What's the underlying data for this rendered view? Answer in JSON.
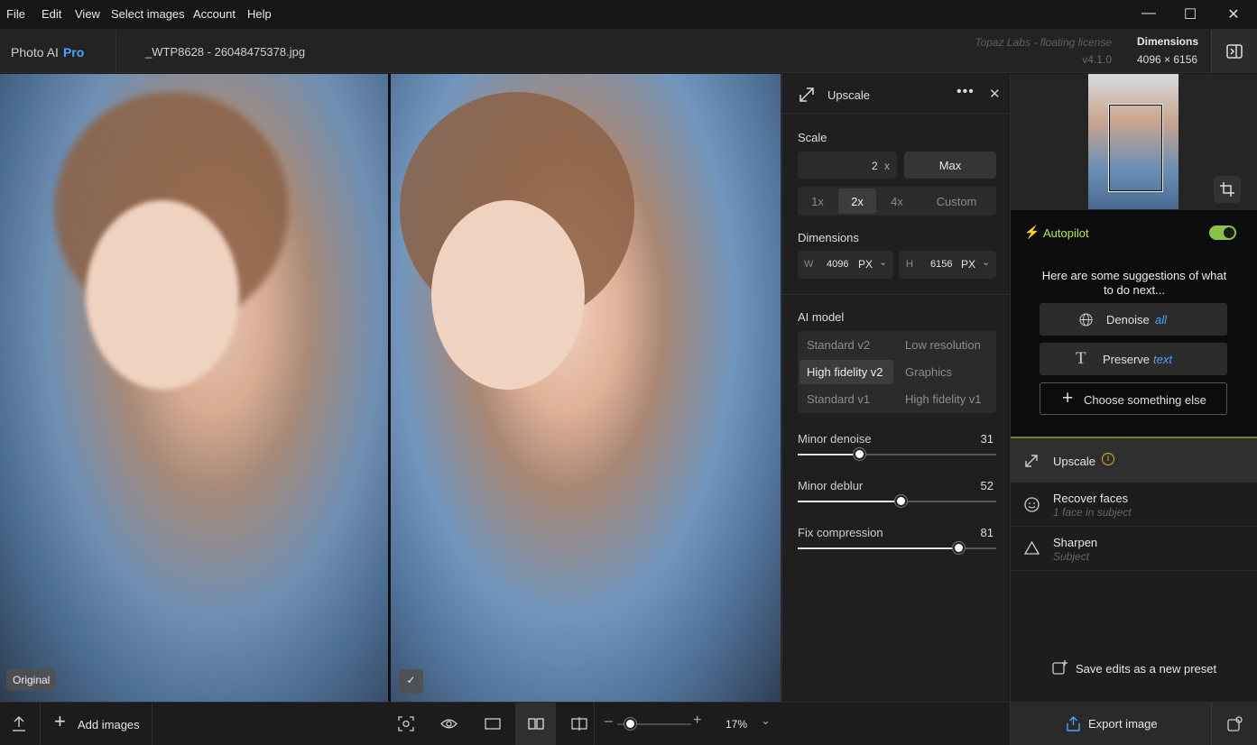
{
  "menu": [
    "File",
    "Edit",
    "View",
    "Select images",
    "Account",
    "Help"
  ],
  "app": {
    "brand": "Photo AI",
    "pro": "Pro",
    "filename": "_WTP8628 - 26048475378.jpg",
    "license": "Topaz Labs - floating license",
    "version": "v4.1.0",
    "dimensions_label": "Dimensions",
    "dimensions_value": "4096 × 6156"
  },
  "viewer": {
    "original_label": "Original"
  },
  "upscale": {
    "title": "Upscale",
    "scale_label": "Scale",
    "scale_value": "2",
    "scale_unit": "x",
    "max_label": "Max",
    "scale_options": [
      "1x",
      "2x",
      "4x",
      "Custom"
    ],
    "selected_scale": "2x",
    "dimensions_label": "Dimensions",
    "width_label": "W",
    "width_value": "4096",
    "width_unit": "PX",
    "height_label": "H",
    "height_value": "6156",
    "height_unit": "PX",
    "ai_model_label": "AI model",
    "models": [
      "Standard v2",
      "Low resolution",
      "High fidelity v2",
      "Graphics",
      "Standard v1",
      "High fidelity v1"
    ],
    "selected_model": "High fidelity v2",
    "sliders": [
      {
        "label": "Minor denoise",
        "value": 31
      },
      {
        "label": "Minor deblur",
        "value": 52
      },
      {
        "label": "Fix compression",
        "value": 81
      }
    ]
  },
  "autopilot": {
    "title": "Autopilot",
    "enabled": true,
    "prompt": "Here are some suggestions of what to do next...",
    "suggestions": [
      {
        "text": "Denoise",
        "accent": "all",
        "icon": "globe-icon"
      },
      {
        "text": "Preserve",
        "accent": "text",
        "icon": "text-icon"
      },
      {
        "text": "Choose something else",
        "accent": "",
        "icon": "plus-icon"
      }
    ],
    "accent_color": "#4da3ff",
    "toggle_color": "#8bc34a"
  },
  "tools": [
    {
      "name": "Upscale",
      "sub": "",
      "icon": "expand-icon"
    },
    {
      "name": "Recover faces",
      "sub": "1 face in subject",
      "icon": "face-icon"
    },
    {
      "name": "Sharpen",
      "sub": "Subject",
      "icon": "triangle-icon"
    }
  ],
  "preset_label": "Save edits as a new preset",
  "bottom": {
    "add_images": "Add images",
    "zoom": "17%",
    "zoom_fraction": 0.17,
    "export": "Export image"
  }
}
